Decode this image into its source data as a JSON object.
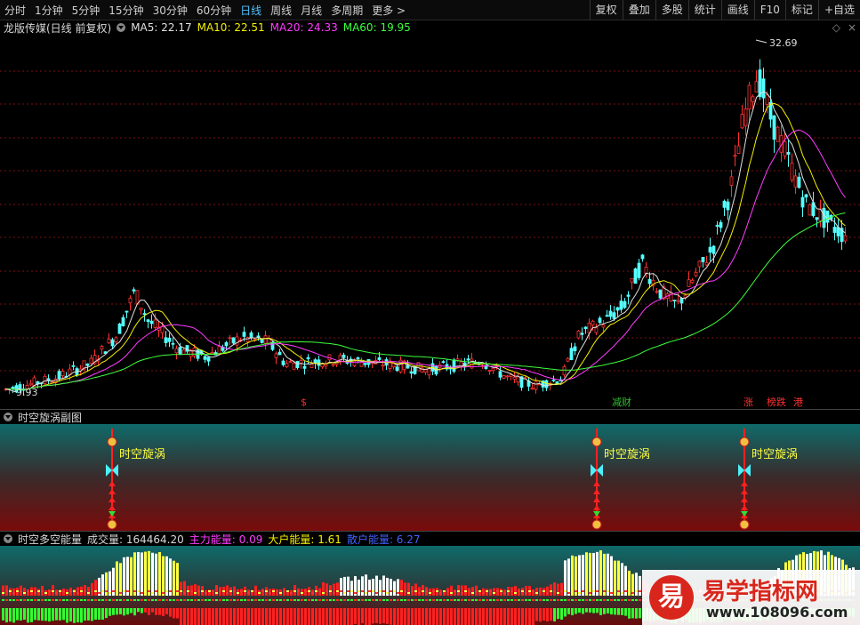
{
  "toolbar": {
    "periods": [
      "分时",
      "1分钟",
      "5分钟",
      "15分钟",
      "30分钟",
      "60分钟",
      "日线",
      "周线",
      "月线",
      "多周期",
      "更多 >"
    ],
    "active_period": "日线",
    "tools": [
      "复权",
      "叠加",
      "多股",
      "统计",
      "画线",
      "F10",
      "标记",
      "+自选"
    ]
  },
  "main_chart": {
    "stock_label": "龙版传媒(日线 前复权)",
    "ma": [
      {
        "name": "MA5",
        "value": "22.17",
        "color": "#e0e0e0"
      },
      {
        "name": "MA10",
        "value": "22.51",
        "color": "#f5f000"
      },
      {
        "name": "MA20",
        "value": "24.33",
        "color": "#ff3cff"
      },
      {
        "name": "MA60",
        "value": "19.95",
        "color": "#3cff3c"
      }
    ],
    "high_label": "32.69",
    "low_label": "9.93",
    "markers": [
      {
        "text": "$",
        "color": "#ff3030"
      },
      {
        "text": "减财",
        "color": "#30c030"
      },
      {
        "text": "涨",
        "color": "#ff3030"
      },
      {
        "text": "榜跌",
        "color": "#ff3030"
      },
      {
        "text": "港",
        "color": "#ff3030"
      }
    ]
  },
  "sub_panel1": {
    "title": "时空旋涡副图",
    "signal_label": "时空旋涡",
    "signal_count": 3
  },
  "sub_panel2": {
    "title": "时空多空能量",
    "volume_label": "成交量: 164464.20",
    "main_energy": {
      "label": "主力能量: 0.09",
      "color": "#ff3cff"
    },
    "big_energy": {
      "label": "大户能量: 1.61",
      "color": "#f5f000"
    },
    "retail_energy": {
      "label": "散户能量: 6.27",
      "color": "#4060ff"
    }
  },
  "watermark": {
    "logo_char": "易",
    "title": "易学指标网",
    "url": "www.108096.com"
  }
}
